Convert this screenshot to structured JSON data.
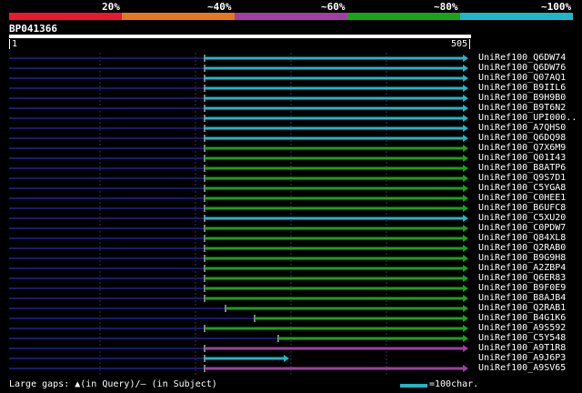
{
  "legend": {
    "labels": [
      "20%",
      "~40%",
      "~60%",
      "~80%",
      "~100%"
    ],
    "colors": [
      "#e8192c",
      "#e87722",
      "#a13ea3",
      "#1aa319",
      "#1fb6c8"
    ]
  },
  "query": {
    "name": "BP041366",
    "start_label": "1",
    "end_label": "505"
  },
  "hits": [
    {
      "name": "UniRef100_Q6DW74",
      "color": "#1fb6c8"
    },
    {
      "name": "UniRef100_Q6DW76",
      "color": "#1fb6c8"
    },
    {
      "name": "UniRef100_Q07AQ1",
      "color": "#1fb6c8"
    },
    {
      "name": "UniRef100_B9IIL6",
      "color": "#1fb6c8"
    },
    {
      "name": "UniRef100_B9H9B0",
      "color": "#1fb6c8"
    },
    {
      "name": "UniRef100_B9T6N2",
      "color": "#1fb6c8"
    },
    {
      "name": "UniRef100_UPI000..",
      "color": "#1fb6c8"
    },
    {
      "name": "UniRef100_A7QHS0",
      "color": "#1fb6c8"
    },
    {
      "name": "UniRef100_Q6DQ98",
      "color": "#1fb6c8"
    },
    {
      "name": "UniRef100_Q7X6M9",
      "color": "#1aa319"
    },
    {
      "name": "UniRef100_Q01I43",
      "color": "#1aa319"
    },
    {
      "name": "UniRef100_B8ATP6",
      "color": "#1aa319"
    },
    {
      "name": "UniRef100_Q9S7D1",
      "color": "#1aa319"
    },
    {
      "name": "UniRef100_C5YGA8",
      "color": "#1aa319"
    },
    {
      "name": "UniRef100_C0HEE1",
      "color": "#1aa319"
    },
    {
      "name": "UniRef100_B6UFC8",
      "color": "#1aa319"
    },
    {
      "name": "UniRef100_C5XU20",
      "color": "#1fb6c8"
    },
    {
      "name": "UniRef100_C0PDW7",
      "color": "#1aa319"
    },
    {
      "name": "UniRef100_Q84XL8",
      "color": "#1aa319"
    },
    {
      "name": "UniRef100_Q2RAB0",
      "color": "#1aa319"
    },
    {
      "name": "UniRef100_B9G9H8",
      "color": "#1aa319"
    },
    {
      "name": "UniRef100_A2ZBP4",
      "color": "#1aa319"
    },
    {
      "name": "UniRef100_Q6ER83",
      "color": "#1aa319"
    },
    {
      "name": "UniRef100_B9F0E9",
      "color": "#1aa319"
    },
    {
      "name": "UniRef100_B8AJB4",
      "color": "#1aa319"
    },
    {
      "name": "UniRef100_Q2RAB1",
      "color": "#1aa319"
    },
    {
      "name": "UniRef100_B4G1K6",
      "color": "#1aa319"
    },
    {
      "name": "UniRef100_A9S592",
      "color": "#1aa319"
    },
    {
      "name": "UniRef100_C5Y548",
      "color": "#1aa319"
    },
    {
      "name": "UniRef100_A9T1R8",
      "color": "#a13ea3"
    },
    {
      "name": "UniRef100_A9J6P3",
      "color": "#1fb6c8"
    },
    {
      "name": "UniRef100_A9SV65",
      "color": "#a13ea3"
    }
  ],
  "footer": {
    "gaps_text": "Large gaps: ▲(in Query)/– (in Subject)",
    "scale_text": "=100char."
  }
}
